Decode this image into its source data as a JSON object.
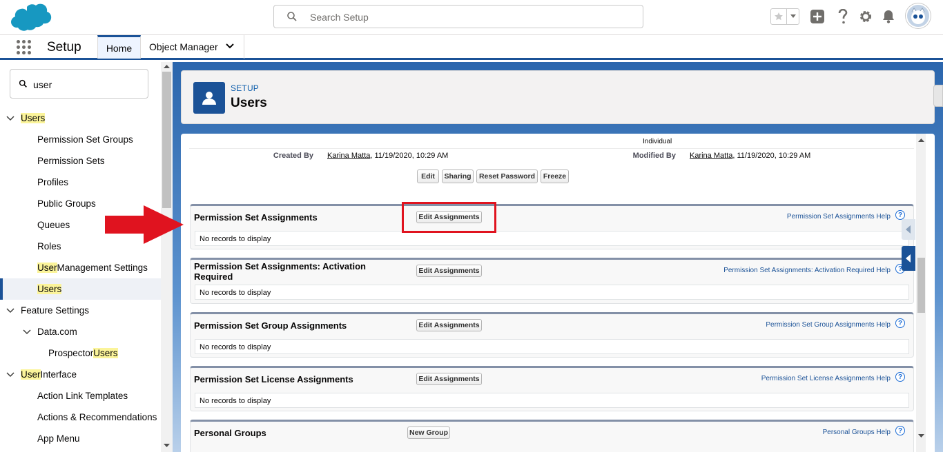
{
  "header": {
    "search_placeholder": "Search Setup"
  },
  "context_bar": {
    "app_name": "Setup",
    "tabs": [
      {
        "label": "Home"
      },
      {
        "label": "Object Manager"
      }
    ]
  },
  "sidebar": {
    "quickfind_value": "user",
    "items": [
      {
        "text_pre": "",
        "text_hl": "Users",
        "text_post": ""
      },
      {
        "text_pre": "Permission Set Groups",
        "text_hl": "",
        "text_post": ""
      },
      {
        "text_pre": "Permission Sets",
        "text_hl": "",
        "text_post": ""
      },
      {
        "text_pre": "Profiles",
        "text_hl": "",
        "text_post": ""
      },
      {
        "text_pre": "Public Groups",
        "text_hl": "",
        "text_post": ""
      },
      {
        "text_pre": "Queues",
        "text_hl": "",
        "text_post": ""
      },
      {
        "text_pre": "Roles",
        "text_hl": "",
        "text_post": ""
      },
      {
        "text_pre": "",
        "text_hl": "User",
        "text_post": " Management Settings"
      },
      {
        "text_pre": "",
        "text_hl": "Users",
        "text_post": ""
      },
      {
        "text_pre": "Feature Settings",
        "text_hl": "",
        "text_post": ""
      },
      {
        "text_pre": "Data.com",
        "text_hl": "",
        "text_post": ""
      },
      {
        "text_pre": "Prospector ",
        "text_hl": "Users",
        "text_post": ""
      },
      {
        "text_pre": "",
        "text_hl": "User",
        "text_post": " Interface"
      },
      {
        "text_pre": "Action Link Templates",
        "text_hl": "",
        "text_post": ""
      },
      {
        "text_pre": "Actions & Recommendations",
        "text_hl": "",
        "text_post": ""
      },
      {
        "text_pre": "App Menu",
        "text_hl": "",
        "text_post": ""
      }
    ]
  },
  "page_header": {
    "eyebrow": "SETUP",
    "title": "Users"
  },
  "detail": {
    "individual_label": "Individual",
    "created_by_label": "Created By",
    "created_by_name": "Karina Matta",
    "created_by_date": ", 11/19/2020, 10:29 AM",
    "modified_by_label": "Modified By",
    "modified_by_name": "Karina Matta",
    "modified_by_date": ", 11/19/2020, 10:29 AM",
    "buttons": [
      "Edit",
      "Sharing",
      "Reset Password",
      "Freeze"
    ]
  },
  "related_lists": [
    {
      "title": "Permission Set Assignments",
      "button": "Edit Assignments",
      "help": "Permission Set Assignments Help",
      "empty": "No records to display"
    },
    {
      "title": "Permission Set Assignments: Activation Required",
      "button": "Edit Assignments",
      "help": "Permission Set Assignments: Activation Required Help",
      "empty": "No records to display"
    },
    {
      "title": "Permission Set Group Assignments",
      "button": "Edit Assignments",
      "help": "Permission Set Group Assignments Help",
      "empty": "No records to display"
    },
    {
      "title": "Permission Set License Assignments",
      "button": "Edit Assignments",
      "help": "Permission Set License Assignments Help",
      "empty": "No records to display"
    },
    {
      "title": "Personal Groups",
      "button": "New Group",
      "help": "Personal Groups Help",
      "empty": ""
    }
  ],
  "help_glyph": "?",
  "colors": {
    "brand_blue": "#1b5297",
    "highlight": "#fbf49a",
    "annotation_red": "#e0131f"
  }
}
